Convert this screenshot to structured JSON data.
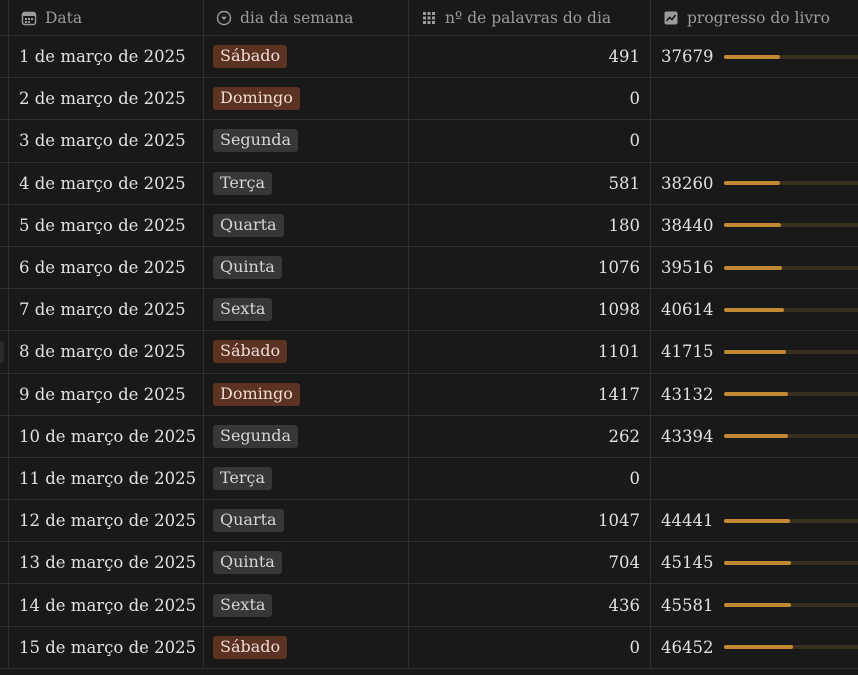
{
  "columns": {
    "date": "Data",
    "weekday": "dia da semana",
    "words": "nº de palavras do dia",
    "progress": "progresso do livro"
  },
  "icons": {
    "date": "calendar-icon",
    "weekday": "select-icon",
    "words": "number-icon",
    "progress": "chart-icon"
  },
  "colors": {
    "weekend_tag_bg": "#5c3322",
    "weekend_tag_text": "#f0dcd3",
    "weekday_tag_bg": "#373737",
    "weekday_tag_text": "#d4d4d4",
    "progress_fill": "#c28832",
    "progress_track": "#3a3020"
  },
  "rows": [
    {
      "date": "1 de março de 2025",
      "weekday": "Sábado",
      "weekend": true,
      "words": "491",
      "progress": "37679",
      "progress_fraction": 0.33
    },
    {
      "date": "2 de março de 2025",
      "weekday": "Domingo",
      "weekend": true,
      "words": "0",
      "progress": "",
      "progress_fraction": null
    },
    {
      "date": "3 de março de 2025",
      "weekday": "Segunda",
      "weekend": false,
      "words": "0",
      "progress": "",
      "progress_fraction": null
    },
    {
      "date": "4 de março de 2025",
      "weekday": "Terça",
      "weekend": false,
      "words": "581",
      "progress": "38260",
      "progress_fraction": 0.335
    },
    {
      "date": "5 de março de 2025",
      "weekday": "Quarta",
      "weekend": false,
      "words": "180",
      "progress": "38440",
      "progress_fraction": 0.336
    },
    {
      "date": "6 de março de 2025",
      "weekday": "Quinta",
      "weekend": false,
      "words": "1076",
      "progress": "39516",
      "progress_fraction": 0.345
    },
    {
      "date": "7 de março de 2025",
      "weekday": "Sexta",
      "weekend": false,
      "words": "1098",
      "progress": "40614",
      "progress_fraction": 0.355
    },
    {
      "date": "8 de março de 2025",
      "weekday": "Sábado",
      "weekend": true,
      "words": "1101",
      "progress": "41715",
      "progress_fraction": 0.365
    },
    {
      "date": "9 de março de 2025",
      "weekday": "Domingo",
      "weekend": true,
      "words": "1417",
      "progress": "43132",
      "progress_fraction": 0.377
    },
    {
      "date": "10 de março de 2025",
      "weekday": "Segunda",
      "weekend": false,
      "words": "262",
      "progress": "43394",
      "progress_fraction": 0.38
    },
    {
      "date": "11 de março de 2025",
      "weekday": "Terça",
      "weekend": false,
      "words": "0",
      "progress": "",
      "progress_fraction": null
    },
    {
      "date": "12 de março de 2025",
      "weekday": "Quarta",
      "weekend": false,
      "words": "1047",
      "progress": "44441",
      "progress_fraction": 0.389
    },
    {
      "date": "13 de março de 2025",
      "weekday": "Quinta",
      "weekend": false,
      "words": "704",
      "progress": "45145",
      "progress_fraction": 0.395
    },
    {
      "date": "14 de março de 2025",
      "weekday": "Sexta",
      "weekend": false,
      "words": "436",
      "progress": "45581",
      "progress_fraction": 0.399
    },
    {
      "date": "15 de março de 2025",
      "weekday": "Sábado",
      "weekend": true,
      "words": "0",
      "progress": "46452",
      "progress_fraction": 0.407
    }
  ]
}
